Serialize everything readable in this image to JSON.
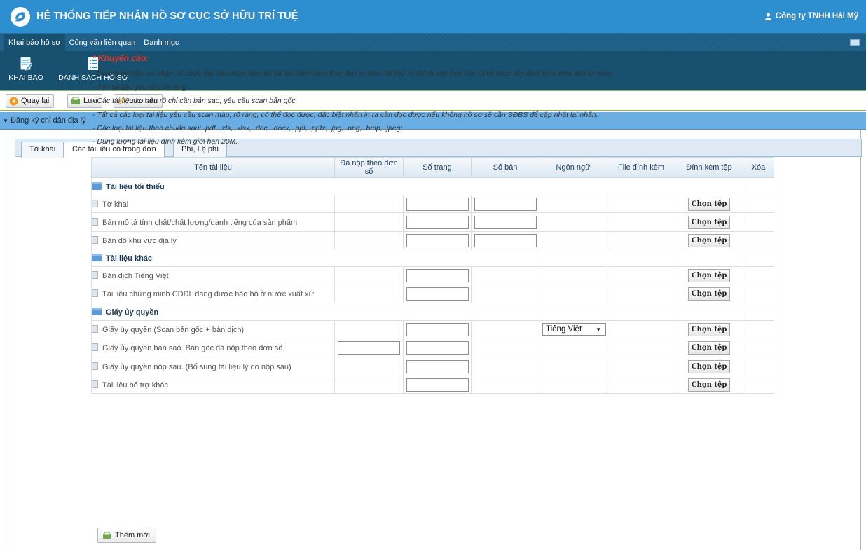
{
  "app": {
    "title": "HỆ THỐNG TIẾP NHẬN HỒ SƠ CỤC SỞ HỮU TRÍ TUỆ",
    "user": "Công ty TNHH Hải Mỹ"
  },
  "menu": {
    "tabs": [
      "Khai báo hồ sơ",
      "Công văn liên quan",
      "Danh mục"
    ]
  },
  "ribbon": {
    "declare_label": "KHAI BÁO",
    "list_label": "DANH SÁCH HỒ SƠ"
  },
  "toolbar": {
    "back_label": "Quay lại",
    "save_label": "Lưu",
    "draft_label": "Lưu tạm"
  },
  "section": {
    "title": "Đăng ký chỉ dẫn địa lý"
  },
  "panel_tabs": [
    "Tờ khai",
    "Các tài liệu có trong đơn",
    "Phí, Lệ phí"
  ],
  "notes": {
    "warning": "* Khuyến cáo:",
    "lines": [
      "- Doanh nghiệp, cá nhân, tổ chức đại diện thực hiện tải tài liệu đính kèm theo thứ tự trên (để thứ tự chính xác bạn cần Click chọn tệp đính kèm theo thứ tự trên)",
      "- Tên tài liệu yêu cầu rõ ràng.",
      "- Các tài liệu ko nêu rõ chỉ cần bản sao, yêu cầu scan bản gốc.",
      "- Tất cả các loại tài liệu yêu cầu scan màu, rõ ràng, có thể đọc được, đặc biệt nhãn in ra cần đọc được nếu không hồ sơ sẽ cần SĐBS để cập nhật lại nhãn.",
      "- Các loại tài liệu theo chuẩn sau: .pdf, .xls, .xlsx, .doc, .docx, .ppt, .pptx, .jpg, .png, .bmp, .jpeg;",
      "- Dung lượng tài liệu đính kèm giới hạn 20M."
    ]
  },
  "table": {
    "headers": [
      "Tên tài liệu",
      "Đã nộp theo đơn số",
      "Số trang",
      "Số bản",
      "Ngôn ngữ",
      "File đính kèm",
      "Đính kèm tệp",
      "Xóa"
    ],
    "choose_label": "Chọn tệp",
    "rows": [
      {
        "type": "group",
        "label": "Tài liệu tối thiểu"
      },
      {
        "type": "doc",
        "label": "Tờ khai"
      },
      {
        "type": "doc",
        "label": "Bản mô tả tính chất/chất lượng/danh tiếng của sản phẩm"
      },
      {
        "type": "doc",
        "label": "Bản đồ khu vực địa lý"
      },
      {
        "type": "group",
        "label": "Tài liệu khác"
      },
      {
        "type": "doc",
        "label": "Bản dịch Tiếng Việt"
      },
      {
        "type": "doc",
        "label": "Tài liệu chứng minh CDĐL đang được bảo hộ ở nước xuất xứ"
      },
      {
        "type": "group",
        "label": "Giấy ủy quyền"
      },
      {
        "type": "doc",
        "label": "Giấy ủy quyền (Scan bản gốc + bản dịch)",
        "language": "Tiếng Việt"
      },
      {
        "type": "doc",
        "label": "Giấy ủy quyền bản sao. Bản gốc đã nộp theo đơn số"
      },
      {
        "type": "doc",
        "label": "Giấy ủy quyền nộp sau. (Bổ sung tài liệu lý do nộp sau)"
      },
      {
        "type": "doc",
        "label": "Tài liệu bổ trợ khác"
      }
    ]
  },
  "add_new_label": "Thêm mới"
}
